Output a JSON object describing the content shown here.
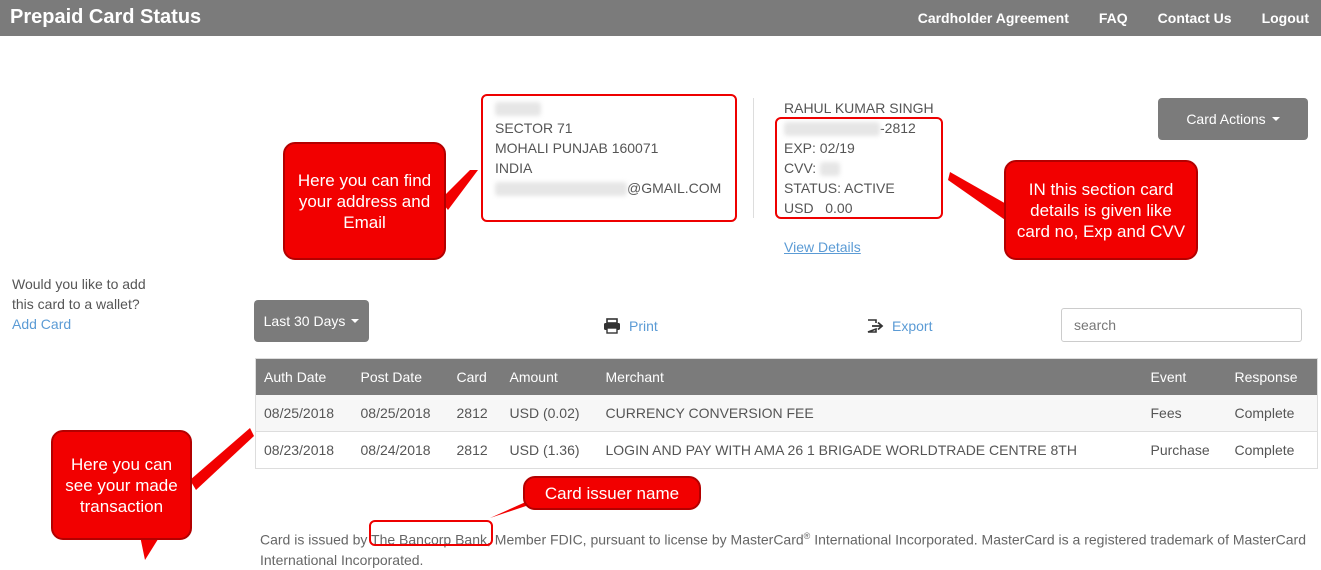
{
  "header": {
    "title": "Prepaid Card Status",
    "nav": [
      "Cardholder Agreement",
      "FAQ",
      "Contact Us",
      "Logout"
    ]
  },
  "address": {
    "line1": "SECTOR 71",
    "line2": "MOHALI PUNJAB 160071",
    "line3": "INDIA",
    "email_suffix": "@GMAIL.COM"
  },
  "card": {
    "holder": "RAHUL KUMAR SINGH",
    "number_suffix": "-2812",
    "exp": "EXP: 02/19",
    "cvv_label": "CVV:",
    "status": "STATUS: ACTIVE",
    "balance_currency": "USD",
    "balance": "0.00",
    "view_details": "View Details",
    "actions_label": "Card Actions"
  },
  "wallet": {
    "prompt": "Would you like to add this card to a wallet?",
    "link": "Add Card"
  },
  "toolbar": {
    "range_label": "Last 30 Days",
    "print_label": "Print",
    "export_label": "Export",
    "search_placeholder": "search"
  },
  "table": {
    "headers": [
      "Auth Date",
      "Post Date",
      "Card",
      "Amount",
      "Merchant",
      "Event",
      "Response"
    ],
    "rows": [
      [
        "08/25/2018",
        "08/25/2018",
        "2812",
        "USD (0.02)",
        "CURRENCY CONVERSION FEE",
        "Fees",
        "Complete"
      ],
      [
        "08/23/2018",
        "08/24/2018",
        "2812",
        "USD (1.36)",
        "LOGIN AND PAY WITH AMA 26 1 BRIGADE WORLDTRADE CENTRE 8TH",
        "Purchase",
        "Complete"
      ]
    ]
  },
  "footer": {
    "prefix": "Card is issued by",
    "bank": "The Bancorp Bank",
    "mid": ", Member FDIC, pursuant to license by MasterCard",
    "reg": "®",
    "rest": " International Incorporated. MasterCard is a registered trademark of MasterCard International Incorporated."
  },
  "annotations": {
    "address_note": "Here you can find your address and Email",
    "card_note": "IN this section card details is given like card no, Exp and CVV",
    "transaction_note": "Here you can see your made transaction",
    "issuer_note": "Card issuer name"
  },
  "colors": {
    "header_bg": "#7b7b7b",
    "link": "#5b9bd5",
    "callout_red": "#f20000"
  }
}
